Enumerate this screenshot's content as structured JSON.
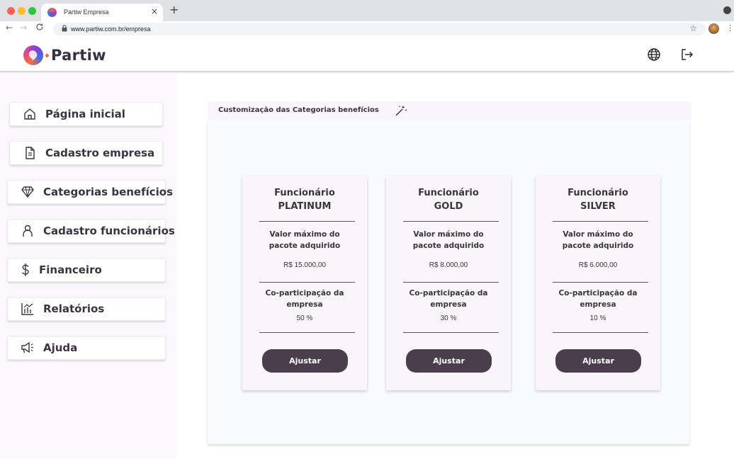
{
  "browser": {
    "tab_title": "Partiw Empresa",
    "tab_close": "×",
    "new_tab": "+",
    "url": "www.partiw.com.br/empresa",
    "back": "←",
    "forward": "→",
    "reload": "C",
    "star": "☆",
    "menu": "⋮"
  },
  "header": {
    "logo_text": "Partiw",
    "icons": [
      "globe-icon",
      "logout-icon"
    ]
  },
  "sidebar": {
    "items": [
      {
        "label": "Página inicial",
        "icon": "home-icon"
      },
      {
        "label": "Cadastro empresa",
        "icon": "document-icon"
      },
      {
        "label": "Categorias  benefícios",
        "icon": "diamond-icon"
      },
      {
        "label": "Cadastro funcionários",
        "icon": "user-icon"
      },
      {
        "label": "Financeiro",
        "icon": "dollar-icon"
      },
      {
        "label": "Relatórios",
        "icon": "chart-icon"
      },
      {
        "label": "Ajuda",
        "icon": "megaphone-icon"
      }
    ]
  },
  "panel": {
    "title": "Customização das Categorias benefícios",
    "title_icon": "magic-wand-icon"
  },
  "cards": [
    {
      "title_line1": "Funcionário",
      "title_line2": "PLATINUM",
      "max_label_line1": "Valor máximo do",
      "max_label_line2": "pacote adquirido",
      "max_value": "R$ 15.000,00",
      "copart_label_line1": "Co-participação da",
      "copart_label_line2": "empresa",
      "copart_value": "50 %",
      "button": "Ajustar"
    },
    {
      "title_line1": "Funcionário",
      "title_line2": "GOLD",
      "max_label_line1": "Valor máximo do",
      "max_label_line2": "pacote adquirido",
      "max_value": "R$ 8.000,00",
      "copart_label_line1": "Co-participação da",
      "copart_label_line2": "empresa",
      "copart_value": "30 %",
      "button": "Ajustar"
    },
    {
      "title_line1": "Funcionário",
      "title_line2": "SILVER",
      "max_label_line1": "Valor máximo do",
      "max_label_line2": "pacote adquirido",
      "max_value": "R$ 6.000,00",
      "copart_label_line1": "Co-participação da",
      "copart_label_line2": "empresa",
      "copart_value": "10 %",
      "button": "Ajustar"
    }
  ],
  "colors": {
    "accent_dark": "#4a3e4c",
    "sidebar_bg": "#fbf7fd",
    "card_bg": "#faf5fb",
    "panel_bg": "#f8fbfc"
  }
}
